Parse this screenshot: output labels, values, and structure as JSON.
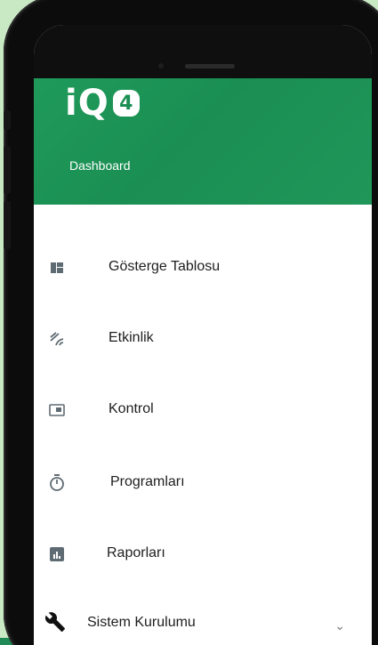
{
  "app": {
    "logo_text": "iQ",
    "logo_badge": "4",
    "subtitle": "Dashboard"
  },
  "menu": {
    "items": [
      {
        "label": "Gösterge Tablosu",
        "icon": "dashboard-icon"
      },
      {
        "label": "Etkinlik",
        "icon": "activity-icon"
      },
      {
        "label": "Kontrol",
        "icon": "control-icon"
      },
      {
        "label": "Programları",
        "icon": "timer-icon"
      },
      {
        "label": "Raporları",
        "icon": "chart-icon"
      },
      {
        "label": "Sistem Kurulumu",
        "icon": "wrench-icon",
        "expand_icon": "chevron-down-icon"
      }
    ]
  },
  "colors": {
    "header_green": "#1b8f53",
    "background": "#c9e8c4",
    "icon_gray": "#5f6b73"
  }
}
